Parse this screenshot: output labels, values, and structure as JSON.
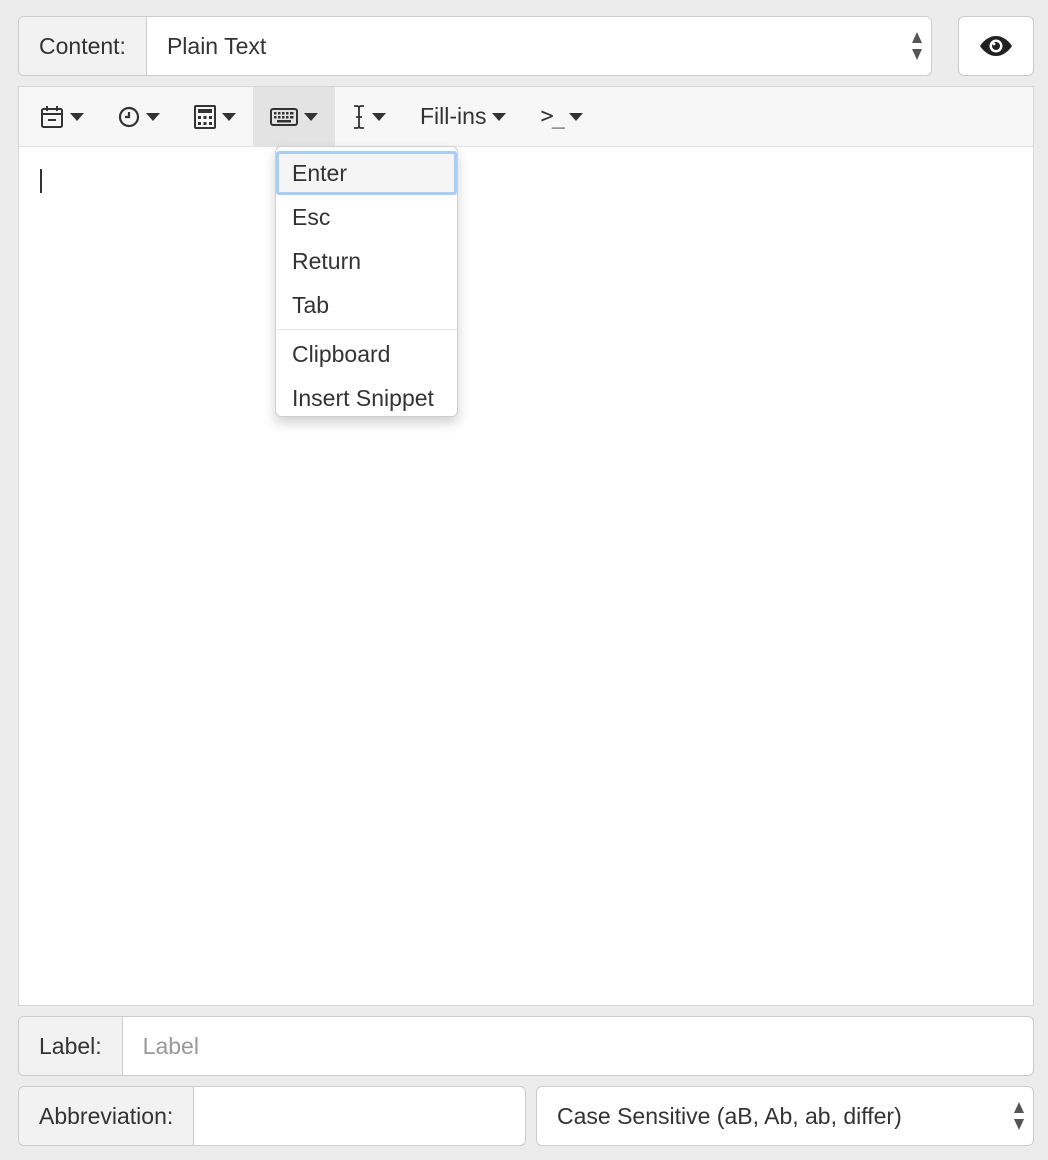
{
  "content": {
    "label": "Content:",
    "selected": "Plain Text"
  },
  "preview": {
    "icon": "eye-icon"
  },
  "toolbar": {
    "buttons": [
      {
        "icon": "calendar-icon"
      },
      {
        "icon": "clock-icon"
      },
      {
        "icon": "calculator-icon"
      },
      {
        "icon": "keyboard-icon",
        "active": true
      },
      {
        "icon": "text-cursor-icon"
      },
      {
        "label": "Fill-ins"
      },
      {
        "icon": "terminal-icon",
        "glyph": ">_"
      }
    ]
  },
  "keyboard_menu": {
    "items": [
      "Enter",
      "Esc",
      "Return",
      "Tab"
    ],
    "extra_items": [
      "Clipboard",
      "Insert Snippet"
    ]
  },
  "label_field": {
    "label": "Label:",
    "placeholder": "Label",
    "value": ""
  },
  "abbreviation_field": {
    "label": "Abbreviation:",
    "value": ""
  },
  "case_select": {
    "selected": "Case Sensitive (aB, Ab, ab, differ)"
  },
  "colors": {
    "focus_ring": "#a9cdf5",
    "background": "#ececec"
  }
}
